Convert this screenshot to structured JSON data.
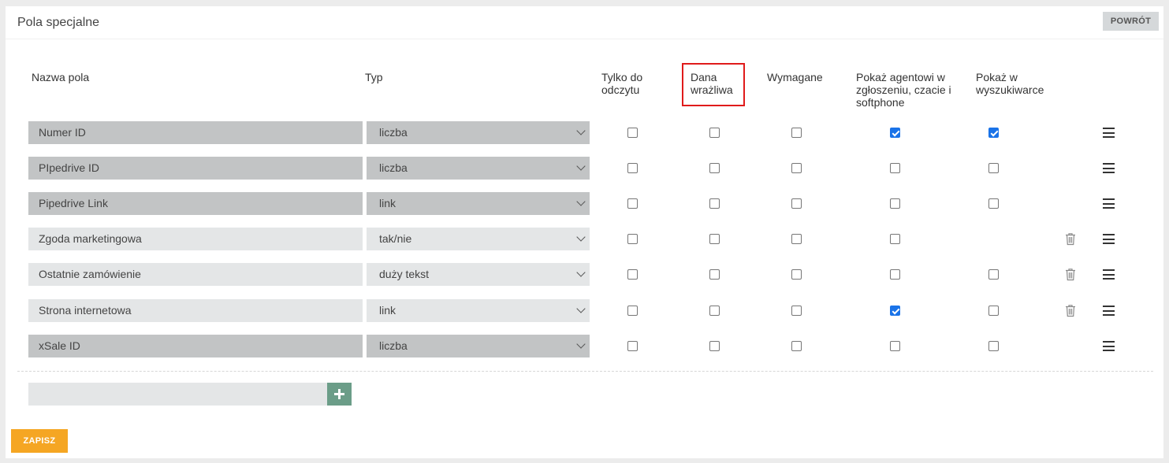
{
  "header": {
    "title": "Pola specjalne",
    "back_label": "POWRÓT"
  },
  "columns": {
    "name": "Nazwa pola",
    "type": "Typ",
    "readonly": "Tylko do odczytu",
    "sensitive": "Dana wrażliwa",
    "required": "Wymagane",
    "show_agent": "Pokaż agentowi w zgłoszeniu, czacie i softphone",
    "show_search": "Pokaż w wyszukiwarce"
  },
  "rows": [
    {
      "name": "Numer ID",
      "type": "liczba",
      "locked": true,
      "readonly": false,
      "sensitive": false,
      "required": false,
      "show_agent": true,
      "show_search": true,
      "has_search_checkbox": true,
      "deletable": false
    },
    {
      "name": "PIpedrive ID",
      "type": "liczba",
      "locked": true,
      "readonly": false,
      "sensitive": false,
      "required": false,
      "show_agent": false,
      "show_search": false,
      "has_search_checkbox": true,
      "deletable": false
    },
    {
      "name": "Pipedrive Link",
      "type": "link",
      "locked": true,
      "readonly": false,
      "sensitive": false,
      "required": false,
      "show_agent": false,
      "show_search": false,
      "has_search_checkbox": true,
      "deletable": false
    },
    {
      "name": "Zgoda marketingowa",
      "type": "tak/nie",
      "locked": false,
      "readonly": false,
      "sensitive": false,
      "required": false,
      "show_agent": false,
      "show_search": false,
      "has_search_checkbox": false,
      "deletable": true
    },
    {
      "name": "Ostatnie zamówienie",
      "type": "duży tekst",
      "locked": false,
      "readonly": false,
      "sensitive": false,
      "required": false,
      "show_agent": false,
      "show_search": false,
      "has_search_checkbox": true,
      "deletable": true
    },
    {
      "name": "Strona internetowa",
      "type": "link",
      "locked": false,
      "readonly": false,
      "sensitive": false,
      "required": false,
      "show_agent": true,
      "show_search": false,
      "has_search_checkbox": true,
      "deletable": true
    },
    {
      "name": "xSale ID",
      "type": "liczba",
      "locked": true,
      "readonly": false,
      "sensitive": false,
      "required": false,
      "show_agent": false,
      "show_search": false,
      "has_search_checkbox": true,
      "deletable": false
    }
  ],
  "new_field": {
    "placeholder": "",
    "value": ""
  },
  "footer": {
    "save_label": "ZAPISZ"
  },
  "colors": {
    "save": "#f5a623",
    "add": "#6b9d88",
    "highlight": "#e01b1b",
    "checked": "#1a73e8"
  }
}
